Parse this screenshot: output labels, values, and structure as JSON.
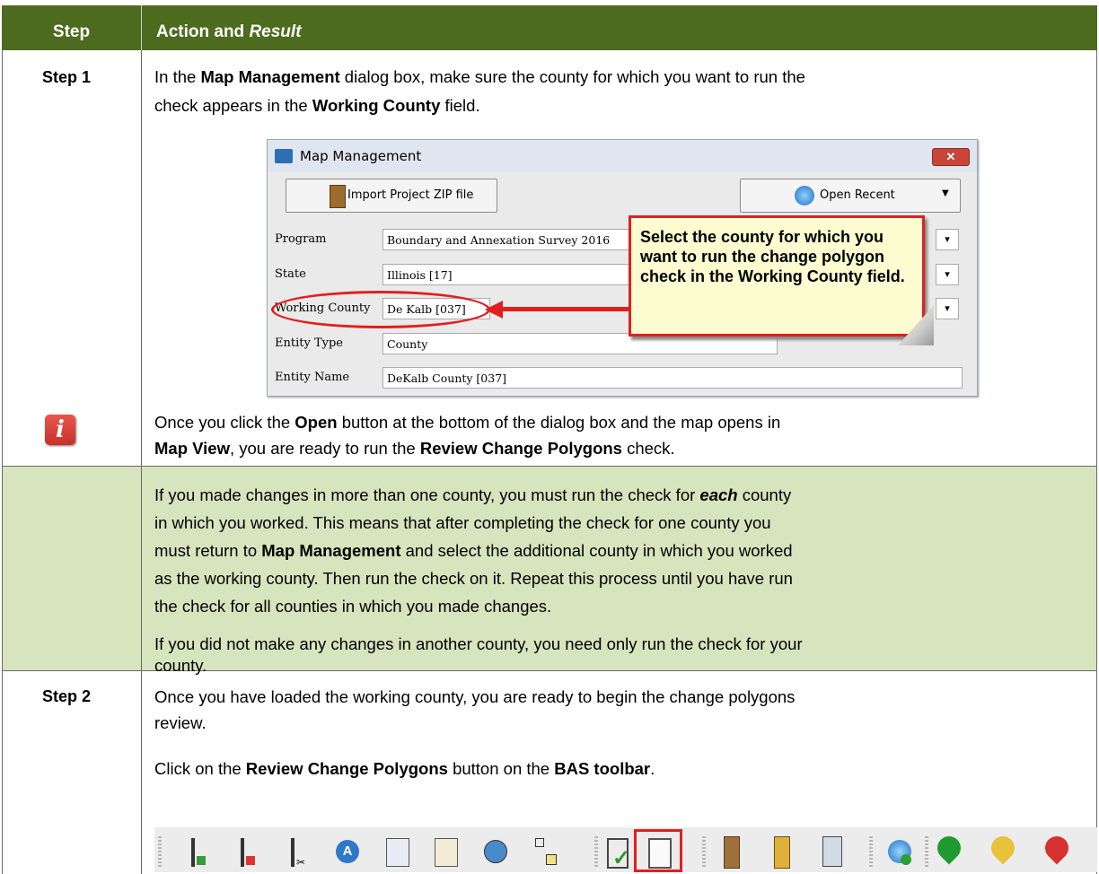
{
  "header": {
    "step": "Step",
    "action": "Action and ",
    "result": "Result"
  },
  "step1": {
    "label": "Step 1",
    "line1_a": "In the ",
    "line1_b": "Map Management",
    "line1_c": " dialog box, make sure the county for which you want to run the",
    "line2_a": "check appears in the ",
    "line2_b": "Working County",
    "line2_c": " field.",
    "after1_a": "Once you click the ",
    "after1_b": "Open",
    "after1_c": " button at the bottom of the dialog box and the map opens in",
    "after2_a": "Map View",
    "after2_b": ", you are ready to run the ",
    "after2_c": "Review Change Polygons",
    "after2_d": " check."
  },
  "dialog": {
    "title": "Map Management",
    "import_label": "Import Project ZIP file",
    "recent_label": "Open Recent",
    "fields": [
      {
        "label": "Program",
        "value": "Boundary and Annexation Survey 2016"
      },
      {
        "label": "State",
        "value": "Illinois [17]"
      },
      {
        "label": "Working County",
        "value": "De Kalb [037]"
      },
      {
        "label": "Entity Type",
        "value": "County"
      },
      {
        "label": "Entity Name",
        "value": "DeKalb County [037]"
      }
    ],
    "callout": "Select the county for which you want to run the change polygon check in the Working County field."
  },
  "note": {
    "p1_a": "If you made changes in more than one county, you must run the check for ",
    "p1_b": "each",
    "p1_c": " county",
    "p1_l2": "in which you worked. This means that after completing the check for one county you",
    "p1_l3a": "must return to ",
    "p1_l3b": "Map Management",
    "p1_l3c": " and select the additional county in which you worked",
    "p1_l4": "as the working county. Then run the check on it. Repeat this process until you have run",
    "p1_l5": "the check for all counties in which you made changes.",
    "p2_l1": "If you did not make any changes in another county, you need only run the check for your",
    "p2_l2": "county."
  },
  "step2": {
    "label": "Step 2",
    "l1": "Once you have loaded the working county, you are ready to begin the change polygons",
    "l2": "review.",
    "l3_a": "Click on the ",
    "l3_b": "Review Change Polygons",
    "l3_c": " button on the ",
    "l3_d": "BAS toolbar",
    "l3_e": "."
  },
  "toolbar_icons": [
    "add-line-icon",
    "delete-line-icon",
    "split-line-icon",
    "address-icon",
    "table-icon",
    "edit-table-icon",
    "users-icon",
    "hierarchy-icon",
    "check-icon",
    "review-change-polygons-icon",
    "zip-export-icon",
    "zip-import-icon",
    "document-export-icon",
    "globe-add-icon",
    "green-pin-icon",
    "yellow-pin-icon",
    "red-pin-icon"
  ],
  "colors": {
    "header": "#4d6b1f",
    "note_bg": "#d7e4bd",
    "highlight": "#e02020"
  }
}
